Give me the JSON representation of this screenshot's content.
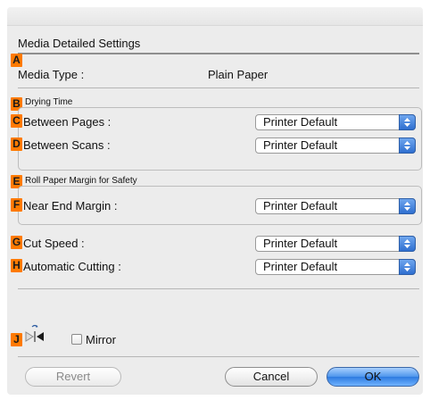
{
  "dialog": {
    "title": "Media Detailed Settings",
    "badges": {
      "a": "A",
      "b": "B",
      "c": "C",
      "d": "D",
      "e": "E",
      "f": "F",
      "g": "G",
      "h": "H",
      "j": "J"
    },
    "media_type": {
      "label": "Media Type :",
      "value": "Plain Paper"
    },
    "drying_time": {
      "heading": "Drying Time",
      "between_pages": {
        "label": "Between Pages :",
        "value": "Printer Default"
      },
      "between_scans": {
        "label": "Between Scans :",
        "value": "Printer Default"
      }
    },
    "roll_paper_margin": {
      "heading": "Roll Paper Margin for Safety",
      "near_end_margin": {
        "label": "Near End Margin :",
        "value": "Printer Default"
      }
    },
    "cut_speed": {
      "label": "Cut Speed :",
      "value": "Printer Default"
    },
    "automatic_cutting": {
      "label": "Automatic Cutting :",
      "value": "Printer Default"
    },
    "mirror": {
      "label": "Mirror",
      "checked": false
    },
    "buttons": {
      "revert": "Revert",
      "cancel": "Cancel",
      "ok": "OK"
    }
  },
  "colors": {
    "badge": "#ff7a00",
    "ok_button": "#4d95ec",
    "popup_arrow": "#2f6fd0",
    "panel_bg": "#ececec"
  }
}
